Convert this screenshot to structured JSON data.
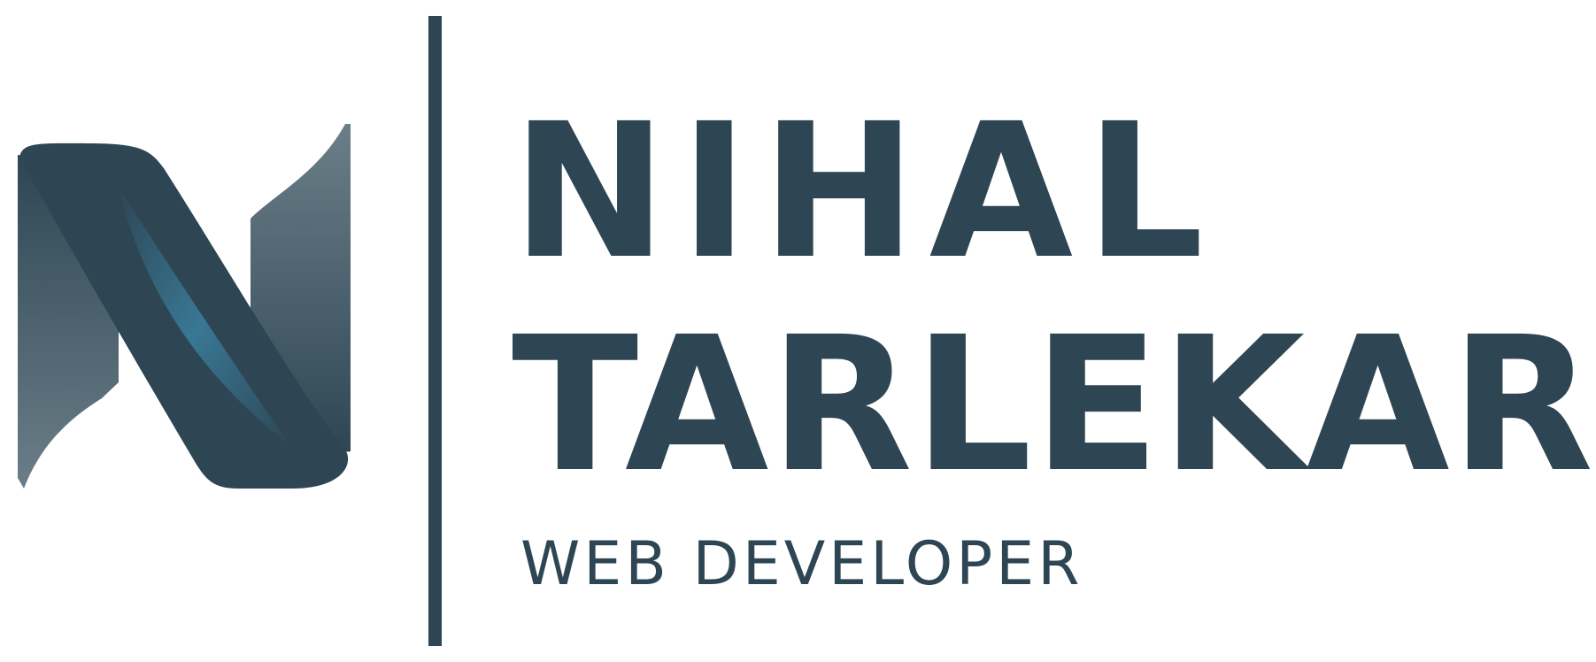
{
  "brand": {
    "first_name": "NIHAL",
    "last_name": "TARLEKAR",
    "tagline": "WEB DEVELOPER"
  },
  "logo": {
    "icon": "n-monogram-icon",
    "primary_color": "#2e4654",
    "light_color": "#6b7e88",
    "accent_color": "#3a7d9c"
  },
  "colors": {
    "text": "#2e4654",
    "background": "#ffffff"
  }
}
